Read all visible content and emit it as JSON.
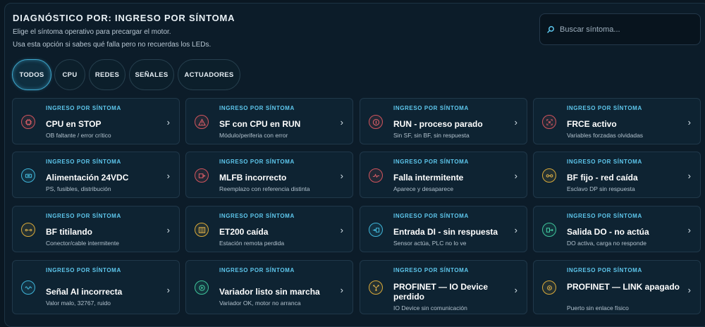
{
  "header": {
    "title": "DIAGNÓSTICO POR: INGRESO POR SÍNTOMA",
    "subtitle_1": "Elige el síntoma operativo para precargar el motor.",
    "subtitle_2": "Usa esta opción si sabes qué falla pero no recuerdas los LEDs."
  },
  "search": {
    "placeholder": "Buscar síntoma...",
    "value": "",
    "icon": "search-icon"
  },
  "tabs": [
    {
      "label": "TODOS",
      "active": true
    },
    {
      "label": "CPU"
    },
    {
      "label": "REDES"
    },
    {
      "label": "SEÑALES"
    },
    {
      "label": "ACTUADORES"
    }
  ],
  "cards": [
    {
      "kicker": "INGRESO POR SÍNTOMA",
      "title": "CPU en STOP",
      "desc": "OB faltante / error crítico",
      "icon": "cpu-icon",
      "color": "#e06069"
    },
    {
      "kicker": "INGRESO POR SÍNTOMA",
      "title": "SF con CPU en RUN",
      "desc": "Módulo/periferia con error",
      "icon": "warning-icon",
      "color": "#e06069"
    },
    {
      "kicker": "INGRESO POR SÍNTOMA",
      "title": "RUN - proceso parado",
      "desc": "Sin SF, sin BF, sin respuesta",
      "icon": "pause-icon",
      "color": "#e06069"
    },
    {
      "kicker": "INGRESO POR SÍNTOMA",
      "title": "FRCE activo",
      "desc": "Variables forzadas olvidadas",
      "icon": "force-icon",
      "color": "#e06069"
    },
    {
      "kicker": "INGRESO POR SÍNTOMA",
      "title": "Alimentación 24VDC",
      "desc": "PS, fusibles, distribución",
      "icon": "battery-icon",
      "color": "#45bde0"
    },
    {
      "kicker": "INGRESO POR SÍNTOMA",
      "title": "MLFB incorrecto",
      "desc": "Reemplazo con referencia distinta",
      "icon": "module-swap-icon",
      "color": "#e06069"
    },
    {
      "kicker": "INGRESO POR SÍNTOMA",
      "title": "Falla intermitente",
      "desc": "Aparece y desaparece",
      "icon": "pulse-icon",
      "color": "#e06069"
    },
    {
      "kicker": "INGRESO POR SÍNTOMA",
      "title": "BF fijo - red caída",
      "desc": "Esclavo DP sin respuesta",
      "icon": "link-icon",
      "color": "#e4b44a"
    },
    {
      "kicker": "INGRESO POR SÍNTOMA",
      "title": "BF titilando",
      "desc": "Conector/cable intermitente",
      "icon": "connector-icon",
      "color": "#e4b44a"
    },
    {
      "kicker": "INGRESO POR SÍNTOMA",
      "title": "ET200 caída",
      "desc": "Estación remota perdida",
      "icon": "rack-icon",
      "color": "#e4b44a"
    },
    {
      "kicker": "INGRESO POR SÍNTOMA",
      "title": "Entrada DI - sin respuesta",
      "desc": "Sensor actúa, PLC no lo ve",
      "icon": "input-icon",
      "color": "#45bde0"
    },
    {
      "kicker": "INGRESO POR SÍNTOMA",
      "title": "Salida DO - no actúa",
      "desc": "DO activa, carga no responde",
      "icon": "output-icon",
      "color": "#45cfa3"
    },
    {
      "kicker": "INGRESO POR SÍNTOMA",
      "title": "Señal AI incorrecta",
      "desc": "Valor malo, 32767, ruido",
      "icon": "wave-icon",
      "color": "#45bde0"
    },
    {
      "kicker": "INGRESO POR SÍNTOMA",
      "title": "Variador listo sin marcha",
      "desc": "Variador OK, motor no arranca",
      "icon": "motor-icon",
      "color": "#45cfa3"
    },
    {
      "kicker": "INGRESO POR SÍNTOMA",
      "title": "PROFINET — IO Device perdido",
      "desc": "IO Device sin comunicación",
      "icon": "network-icon",
      "color": "#e4b44a"
    },
    {
      "kicker": "INGRESO POR SÍNTOMA",
      "title": "PROFINET — LINK apagado",
      "desc": "Puerto sin enlace físico",
      "icon": "port-icon",
      "color": "#e4b44a"
    }
  ],
  "chevron": "›"
}
